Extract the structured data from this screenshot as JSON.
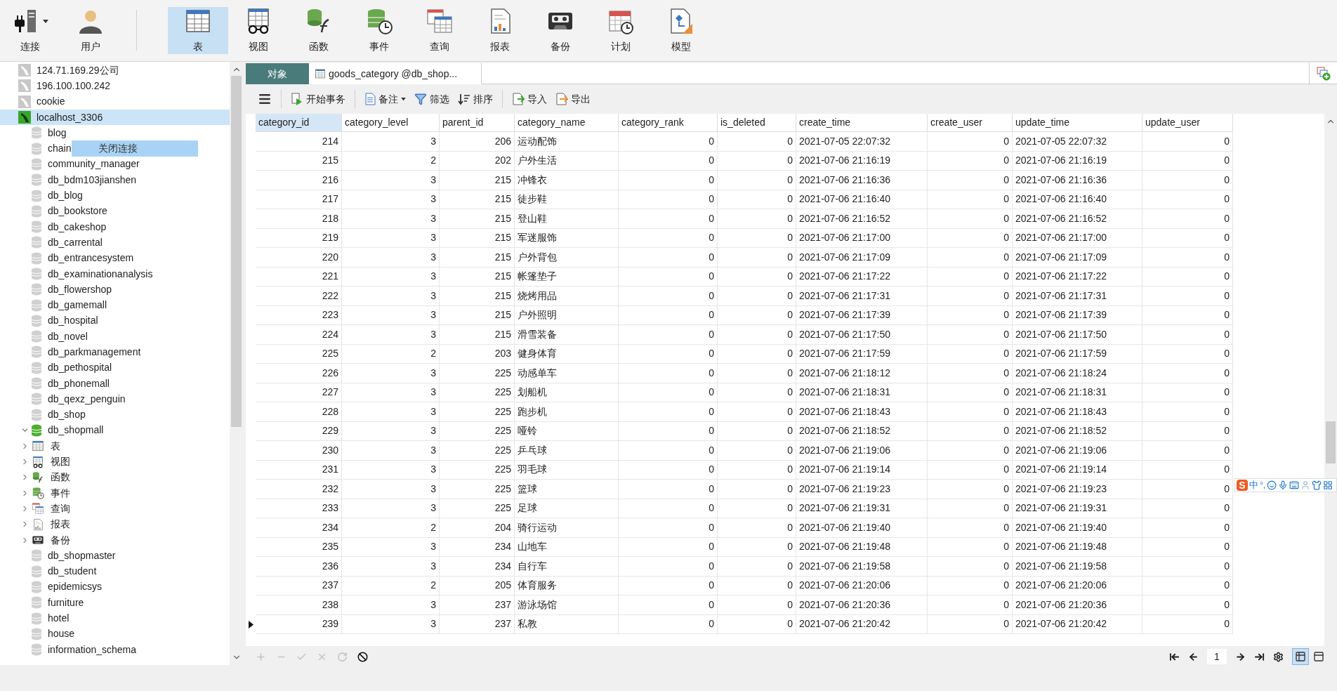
{
  "toolbar": {
    "items": [
      {
        "kind": "connect",
        "label": "连接",
        "dropdown": true,
        "selected": false
      },
      {
        "kind": "user",
        "label": "用户",
        "selected": false
      },
      {
        "kind": "table",
        "label": "表",
        "selected": true
      },
      {
        "kind": "view",
        "label": "视图",
        "selected": false
      },
      {
        "kind": "function",
        "label": "函数",
        "selected": false
      },
      {
        "kind": "event",
        "label": "事件",
        "selected": false
      },
      {
        "kind": "query",
        "label": "查询",
        "selected": false
      },
      {
        "kind": "report",
        "label": "报表",
        "selected": false
      },
      {
        "kind": "backup",
        "label": "备份",
        "selected": false
      },
      {
        "kind": "schedule",
        "label": "计划",
        "selected": false
      },
      {
        "kind": "model",
        "label": "模型",
        "selected": false
      }
    ]
  },
  "sidebar": {
    "items": [
      {
        "kind": "connection",
        "name": "124.71.169.29公司",
        "open": false,
        "selected": false
      },
      {
        "kind": "connection",
        "name": "196.100.100.242",
        "open": false,
        "selected": false
      },
      {
        "kind": "connection",
        "name": "cookie",
        "open": false,
        "selected": false
      },
      {
        "kind": "connection",
        "name": "localhost_3306",
        "open": true,
        "selected": true,
        "children": [
          {
            "kind": "database",
            "name": "blog",
            "open": false
          },
          {
            "kind": "database",
            "name": "chain",
            "open": false
          },
          {
            "kind": "database",
            "name": "community_manager",
            "open": false
          },
          {
            "kind": "database",
            "name": "db_bdm103jianshen",
            "open": false
          },
          {
            "kind": "database",
            "name": "db_blog",
            "open": false
          },
          {
            "kind": "database",
            "name": "db_bookstore",
            "open": false
          },
          {
            "kind": "database",
            "name": "db_cakeshop",
            "open": false
          },
          {
            "kind": "database",
            "name": "db_carrental",
            "open": false
          },
          {
            "kind": "database",
            "name": "db_entrancesystem",
            "open": false
          },
          {
            "kind": "database",
            "name": "db_examinationanalysis",
            "open": false
          },
          {
            "kind": "database",
            "name": "db_flowershop",
            "open": false
          },
          {
            "kind": "database",
            "name": "db_gamemall",
            "open": false
          },
          {
            "kind": "database",
            "name": "db_hospital",
            "open": false
          },
          {
            "kind": "database",
            "name": "db_novel",
            "open": false
          },
          {
            "kind": "database",
            "name": "db_parkmanagement",
            "open": false
          },
          {
            "kind": "database",
            "name": "db_pethospital",
            "open": false
          },
          {
            "kind": "database",
            "name": "db_phonemall",
            "open": false
          },
          {
            "kind": "database",
            "name": "db_qexz_penguin",
            "open": false
          },
          {
            "kind": "database",
            "name": "db_shop",
            "open": false
          },
          {
            "kind": "database",
            "name": "db_shopmall",
            "open": true,
            "expanded": true,
            "children": [
              {
                "kind": "table",
                "name": "表",
                "expanded": false
              },
              {
                "kind": "view",
                "name": "视图",
                "expanded": false
              },
              {
                "kind": "function",
                "name": "函数",
                "expanded": false
              },
              {
                "kind": "event",
                "name": "事件",
                "expanded": false
              },
              {
                "kind": "query",
                "name": "查询",
                "expanded": false
              },
              {
                "kind": "report",
                "name": "报表",
                "expanded": false
              },
              {
                "kind": "backup",
                "name": "备份",
                "expanded": false
              }
            ]
          },
          {
            "kind": "database",
            "name": "db_shopmaster",
            "open": false
          },
          {
            "kind": "database",
            "name": "db_student",
            "open": false
          },
          {
            "kind": "database",
            "name": "epidemicsys",
            "open": false
          },
          {
            "kind": "database",
            "name": "furniture",
            "open": false
          },
          {
            "kind": "database",
            "name": "hotel",
            "open": false
          },
          {
            "kind": "database",
            "name": "house",
            "open": false
          },
          {
            "kind": "database",
            "name": "information_schema",
            "open": false
          }
        ]
      }
    ]
  },
  "context_menu": {
    "items": [
      "关闭连接"
    ]
  },
  "tabs": [
    {
      "kind": "objects",
      "label": "对象",
      "selected": false
    },
    {
      "kind": "table",
      "label": "goods_category @db_shop...",
      "selected": true
    }
  ],
  "table_toolbar": {
    "groups": [
      {
        "items": [
          {
            "kind": "menu"
          }
        ]
      },
      {
        "items": [
          {
            "kind": "begin",
            "label": "开始事务"
          }
        ]
      },
      {
        "items": [
          {
            "kind": "comment",
            "label": "备注",
            "dropdown": true
          },
          {
            "kind": "filter",
            "label": "筛选"
          },
          {
            "kind": "sort",
            "label": "排序"
          }
        ]
      },
      {
        "items": [
          {
            "kind": "import",
            "label": "导入"
          },
          {
            "kind": "export",
            "label": "导出"
          }
        ]
      }
    ]
  },
  "table": {
    "columns": [
      {
        "label": "category_id",
        "selected": true
      },
      {
        "label": "category_level",
        "selected": false
      },
      {
        "label": "parent_id",
        "selected": false
      },
      {
        "label": "category_name",
        "selected": false
      },
      {
        "label": "category_rank",
        "selected": false
      },
      {
        "label": "is_deleted",
        "selected": false
      },
      {
        "label": "create_time",
        "selected": false
      },
      {
        "label": "create_user",
        "selected": false
      },
      {
        "label": "update_time",
        "selected": false
      },
      {
        "label": "update_user",
        "selected": false
      }
    ],
    "rows": [
      {
        "selected": false,
        "cells": [
          "214",
          "3",
          "206",
          "运动配饰",
          "0",
          "0",
          "2021-07-05 22:07:32",
          "0",
          "2021-07-05 22:07:32",
          "0"
        ]
      },
      {
        "selected": false,
        "cells": [
          "215",
          "2",
          "202",
          "户外生活",
          "0",
          "0",
          "2021-07-06 21:16:19",
          "0",
          "2021-07-06 21:16:19",
          "0"
        ]
      },
      {
        "selected": false,
        "cells": [
          "216",
          "3",
          "215",
          "冲锋衣",
          "0",
          "0",
          "2021-07-06 21:16:36",
          "0",
          "2021-07-06 21:16:36",
          "0"
        ]
      },
      {
        "selected": false,
        "cells": [
          "217",
          "3",
          "215",
          "徒步鞋",
          "0",
          "0",
          "2021-07-06 21:16:40",
          "0",
          "2021-07-06 21:16:40",
          "0"
        ]
      },
      {
        "selected": false,
        "cells": [
          "218",
          "3",
          "215",
          "登山鞋",
          "0",
          "0",
          "2021-07-06 21:16:52",
          "0",
          "2021-07-06 21:16:52",
          "0"
        ]
      },
      {
        "selected": false,
        "cells": [
          "219",
          "3",
          "215",
          "军迷服饰",
          "0",
          "0",
          "2021-07-06 21:17:00",
          "0",
          "2021-07-06 21:17:00",
          "0"
        ]
      },
      {
        "selected": false,
        "cells": [
          "220",
          "3",
          "215",
          "户外背包",
          "0",
          "0",
          "2021-07-06 21:17:09",
          "0",
          "2021-07-06 21:17:09",
          "0"
        ]
      },
      {
        "selected": false,
        "cells": [
          "221",
          "3",
          "215",
          "帐篷垫子",
          "0",
          "0",
          "2021-07-06 21:17:22",
          "0",
          "2021-07-06 21:17:22",
          "0"
        ]
      },
      {
        "selected": false,
        "cells": [
          "222",
          "3",
          "215",
          "烧烤用品",
          "0",
          "0",
          "2021-07-06 21:17:31",
          "0",
          "2021-07-06 21:17:31",
          "0"
        ]
      },
      {
        "selected": false,
        "cells": [
          "223",
          "3",
          "215",
          "户外照明",
          "0",
          "0",
          "2021-07-06 21:17:39",
          "0",
          "2021-07-06 21:17:39",
          "0"
        ]
      },
      {
        "selected": false,
        "cells": [
          "224",
          "3",
          "215",
          "滑雪装备",
          "0",
          "0",
          "2021-07-06 21:17:50",
          "0",
          "2021-07-06 21:17:50",
          "0"
        ]
      },
      {
        "selected": false,
        "cells": [
          "225",
          "2",
          "203",
          "健身体育",
          "0",
          "0",
          "2021-07-06 21:17:59",
          "0",
          "2021-07-06 21:17:59",
          "0"
        ]
      },
      {
        "selected": false,
        "cells": [
          "226",
          "3",
          "225",
          "动感单车",
          "0",
          "0",
          "2021-07-06 21:18:12",
          "0",
          "2021-07-06 21:18:24",
          "0"
        ]
      },
      {
        "selected": false,
        "cells": [
          "227",
          "3",
          "225",
          "划船机",
          "0",
          "0",
          "2021-07-06 21:18:31",
          "0",
          "2021-07-06 21:18:31",
          "0"
        ]
      },
      {
        "selected": false,
        "cells": [
          "228",
          "3",
          "225",
          "跑步机",
          "0",
          "0",
          "2021-07-06 21:18:43",
          "0",
          "2021-07-06 21:18:43",
          "0"
        ]
      },
      {
        "selected": false,
        "cells": [
          "229",
          "3",
          "225",
          "哑铃",
          "0",
          "0",
          "2021-07-06 21:18:52",
          "0",
          "2021-07-06 21:18:52",
          "0"
        ]
      },
      {
        "selected": false,
        "cells": [
          "230",
          "3",
          "225",
          "乒乓球",
          "0",
          "0",
          "2021-07-06 21:19:06",
          "0",
          "2021-07-06 21:19:06",
          "0"
        ]
      },
      {
        "selected": false,
        "cells": [
          "231",
          "3",
          "225",
          "羽毛球",
          "0",
          "0",
          "2021-07-06 21:19:14",
          "0",
          "2021-07-06 21:19:14",
          "0"
        ]
      },
      {
        "selected": false,
        "cells": [
          "232",
          "3",
          "225",
          "篮球",
          "0",
          "0",
          "2021-07-06 21:19:23",
          "0",
          "2021-07-06 21:19:23",
          "0"
        ]
      },
      {
        "selected": false,
        "cells": [
          "233",
          "3",
          "225",
          "足球",
          "0",
          "0",
          "2021-07-06 21:19:31",
          "0",
          "2021-07-06 21:19:31",
          "0"
        ]
      },
      {
        "selected": false,
        "cells": [
          "234",
          "2",
          "204",
          "骑行运动",
          "0",
          "0",
          "2021-07-06 21:19:40",
          "0",
          "2021-07-06 21:19:40",
          "0"
        ]
      },
      {
        "selected": false,
        "cells": [
          "235",
          "3",
          "234",
          "山地车",
          "0",
          "0",
          "2021-07-06 21:19:48",
          "0",
          "2021-07-06 21:19:48",
          "0"
        ]
      },
      {
        "selected": false,
        "cells": [
          "236",
          "3",
          "234",
          "自行车",
          "0",
          "0",
          "2021-07-06 21:19:58",
          "0",
          "2021-07-06 21:19:58",
          "0"
        ]
      },
      {
        "selected": false,
        "cells": [
          "237",
          "2",
          "205",
          "体育服务",
          "0",
          "0",
          "2021-07-06 21:20:06",
          "0",
          "2021-07-06 21:20:06",
          "0"
        ]
      },
      {
        "selected": false,
        "cells": [
          "238",
          "3",
          "237",
          "游泳场馆",
          "0",
          "0",
          "2021-07-06 21:20:36",
          "0",
          "2021-07-06 21:20:36",
          "0"
        ]
      },
      {
        "selected": true,
        "cells": [
          "239",
          "3",
          "237",
          "私教",
          "0",
          "0",
          "2021-07-06 21:20:42",
          "0",
          "2021-07-06 21:20:42",
          "0"
        ]
      }
    ]
  },
  "bottom_bar": {
    "edit_buttons": [
      {
        "kind": "add",
        "disabled": true
      },
      {
        "kind": "delete",
        "disabled": true
      },
      {
        "kind": "apply",
        "disabled": true
      },
      {
        "kind": "discard",
        "disabled": true
      },
      {
        "kind": "refresh",
        "disabled": true
      },
      {
        "kind": "stop",
        "disabled": false
      }
    ],
    "page": "1",
    "view_modes": [
      {
        "kind": "grid",
        "selected": true
      },
      {
        "kind": "form",
        "selected": false
      }
    ]
  },
  "ime_bar": {
    "logo": "S",
    "mode": "中",
    "punctuation": "°,"
  }
}
